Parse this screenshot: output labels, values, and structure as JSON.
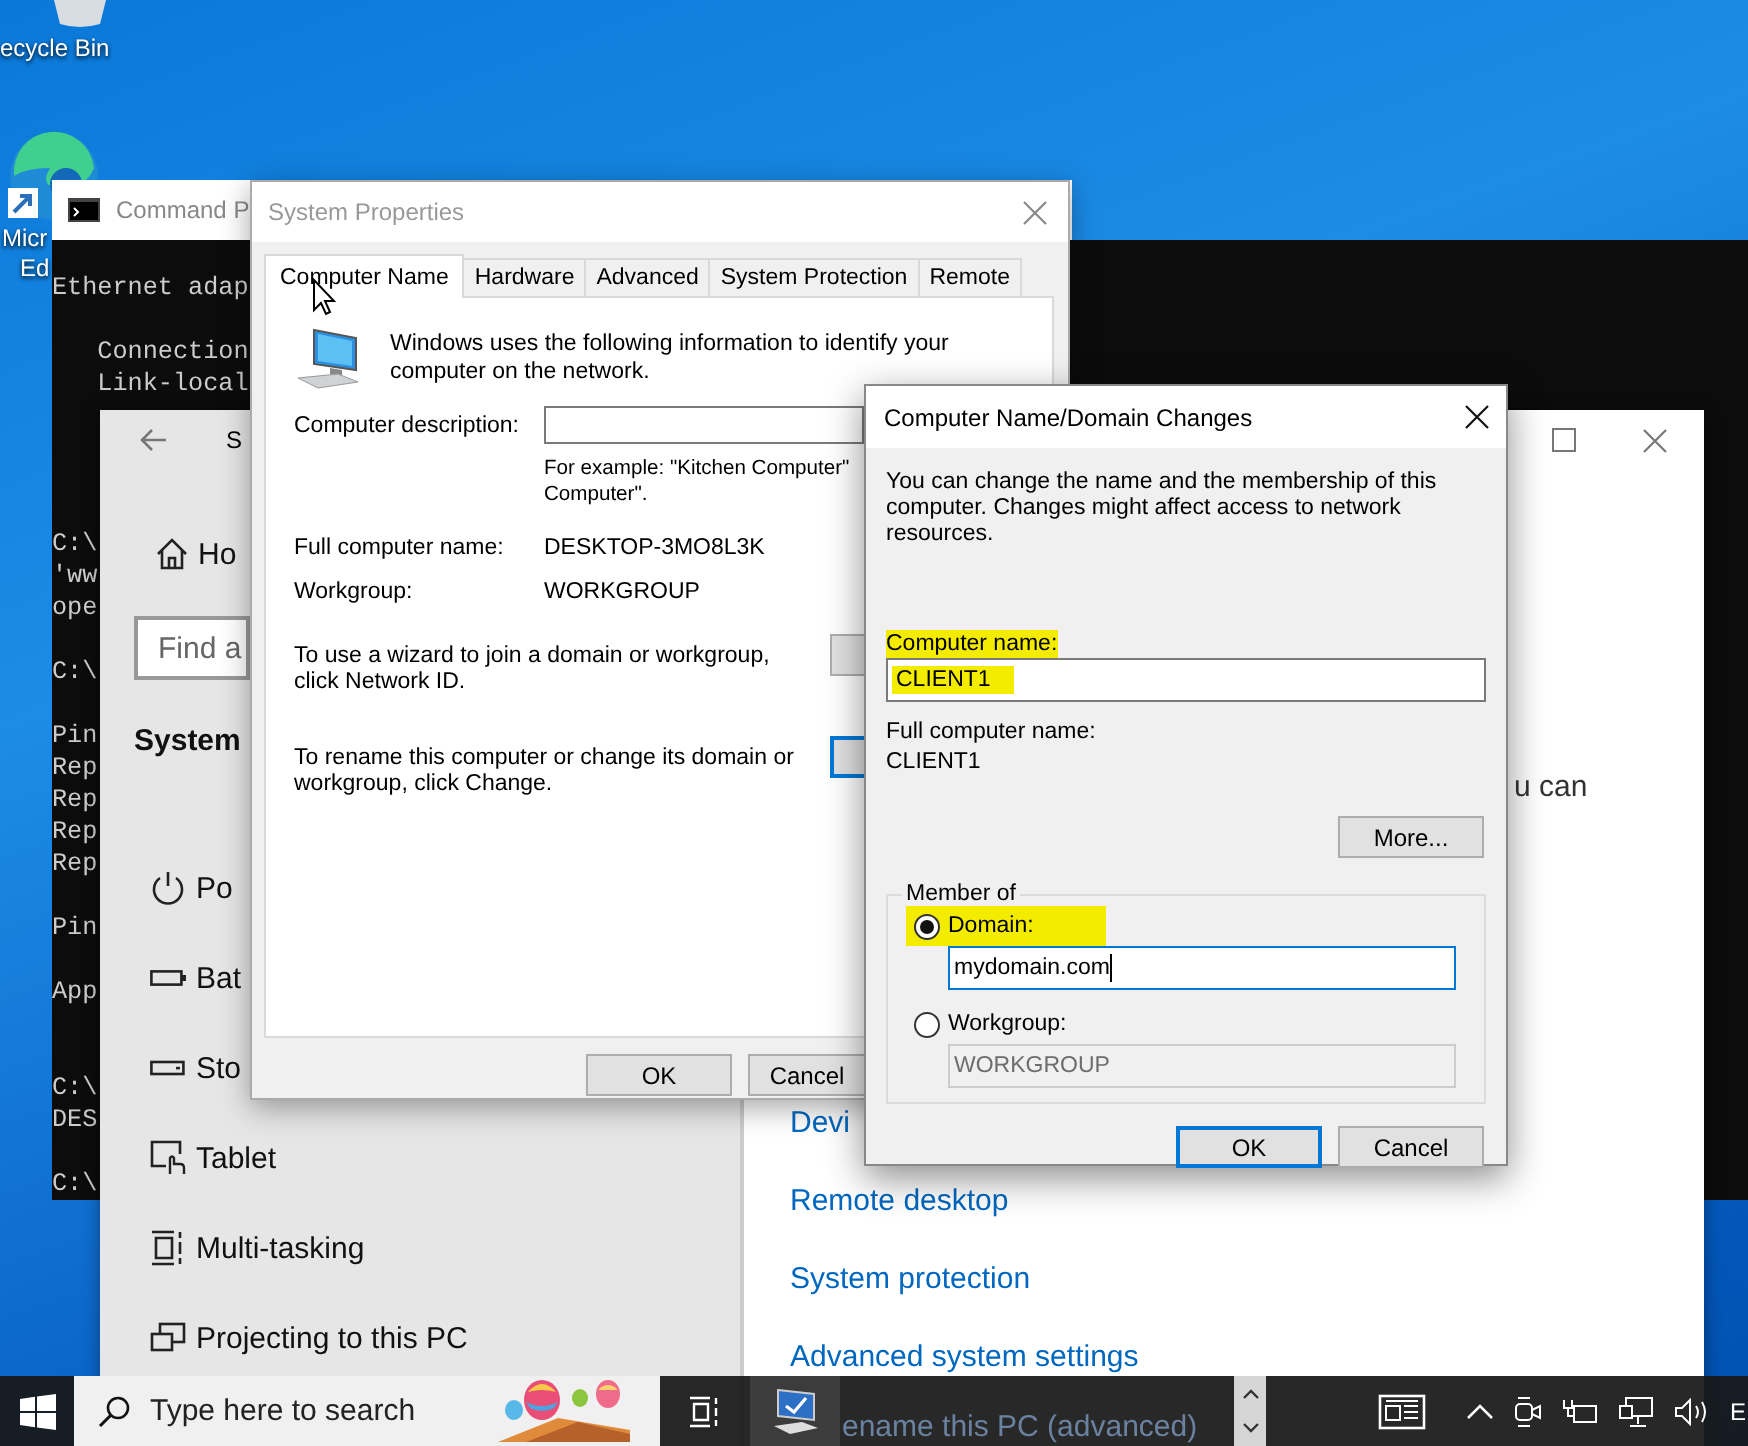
{
  "desktop_icons": [
    {
      "kind": "recycle-bin",
      "label_lines": [
        "ecycle Bin"
      ]
    },
    {
      "kind": "edge",
      "label_lines": [
        "Micr",
        "Ed"
      ]
    }
  ],
  "command_prompt": {
    "title": "Command P",
    "output_top": "Ethernet adap\n\n   Connection\n   Link-local",
    "output_left": "C:\\\n'ww\nope\n\nC:\\\n\nPin\nRep\nRep\nRep\nRep\n\nPin\n\nApp\n\n\nC:\\\nDES\n\nC:\\"
  },
  "settings": {
    "title": "S",
    "home": "Ho",
    "search": {
      "placeholder": "Find a"
    },
    "section": "System",
    "nav": [
      {
        "kind": "power",
        "label": "Po"
      },
      {
        "kind": "battery",
        "label": "Bat"
      },
      {
        "kind": "storage",
        "label": "Sto"
      },
      {
        "kind": "tablet",
        "label": "Tablet"
      },
      {
        "kind": "multitasking",
        "label": "Multi-tasking"
      },
      {
        "kind": "projecting",
        "label": "Projecting to this PC"
      }
    ],
    "content_fragment": "u can",
    "links": [
      "Devi",
      "Remote desktop",
      "System protection",
      "Advanced system settings"
    ],
    "covered_link": "ename this PC (advanced)"
  },
  "system_properties": {
    "title": "System Properties",
    "tabs": [
      {
        "label": "Computer Name",
        "selected": true
      },
      {
        "label": "Hardware",
        "selected": false
      },
      {
        "label": "Advanced",
        "selected": false
      },
      {
        "label": "System Protection",
        "selected": false
      },
      {
        "label": "Remote",
        "selected": false
      }
    ],
    "intro": "Windows uses the following information to identify your computer on the network.",
    "description_label": "Computer description:",
    "description_hint_lines": [
      "For example: \"Kitchen Computer\"",
      "Computer\"."
    ],
    "full_name_label": "Full computer name:",
    "full_name": "DESKTOP-3MO8L3K",
    "workgroup_label": "Workgroup:",
    "workgroup": "WORKGROUP",
    "network_id_text": "To use a wizard to join a domain or workgroup, click Network ID.",
    "network_id_button": {
      "default": false
    },
    "change_text": "To rename this computer or change its domain or workgroup, click Change.",
    "change_button": {
      "default": true
    },
    "buttons": [
      {
        "label": "OK",
        "default": false
      },
      {
        "label": "Cancel",
        "default": false
      }
    ]
  },
  "name_changes_dialog": {
    "title": "Computer Name/Domain Changes",
    "intro": "You can change the name and the membership of this computer. Changes might affect access to network resources.",
    "computer_name": {
      "label": "Computer name:",
      "value": "CLIENT1",
      "highlighted": true
    },
    "full_name_label": "Full computer name:",
    "full_name": "CLIENT1",
    "more_button": "More...",
    "member_of": {
      "title": "Member of",
      "options": [
        {
          "label": "Domain:",
          "selected": true,
          "value": "mydomain.com",
          "highlighted": true
        },
        {
          "label": "Workgroup:",
          "selected": false,
          "value": "WORKGROUP",
          "highlighted": false
        }
      ]
    },
    "buttons": [
      {
        "label": "OK",
        "default": true
      },
      {
        "label": "Cancel",
        "default": false
      }
    ]
  },
  "taskbar": {
    "search": {
      "placeholder": "Type here to search"
    },
    "language": "E"
  }
}
